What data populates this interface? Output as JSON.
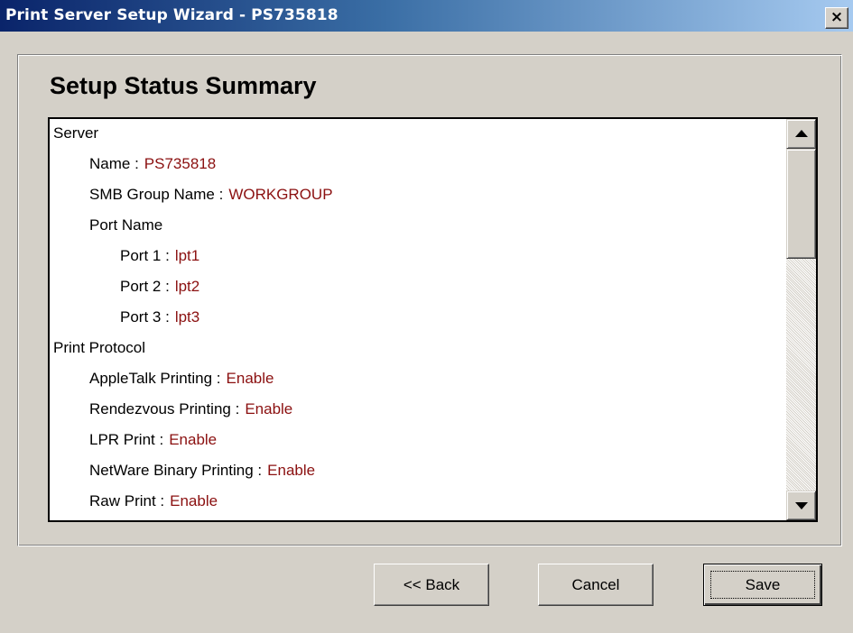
{
  "window": {
    "title": "Print Server Setup Wizard - PS735818",
    "close_glyph": "×"
  },
  "heading": "Setup Status Summary",
  "summary": {
    "rows": [
      {
        "label": "Server",
        "value": ""
      },
      {
        "label": "Name :",
        "value": "PS735818"
      },
      {
        "label": "SMB Group Name :",
        "value": "WORKGROUP"
      },
      {
        "label": "Port Name",
        "value": ""
      },
      {
        "label": "Port 1 :",
        "value": "lpt1"
      },
      {
        "label": "Port 2 :",
        "value": "lpt2"
      },
      {
        "label": "Port 3 :",
        "value": "lpt3"
      },
      {
        "label": "Print Protocol",
        "value": ""
      },
      {
        "label": "AppleTalk Printing :",
        "value": "Enable"
      },
      {
        "label": "Rendezvous Printing :",
        "value": "Enable"
      },
      {
        "label": "LPR Print :",
        "value": "Enable"
      },
      {
        "label": "NetWare Binary Printing :",
        "value": "Enable"
      },
      {
        "label": "Raw Print :",
        "value": "Enable"
      }
    ]
  },
  "buttons": {
    "back": "<< Back",
    "cancel": "Cancel",
    "save": "Save"
  },
  "icons": {
    "close": "close-icon",
    "scroll_up": "arrow-up-icon",
    "scroll_down": "arrow-down-icon"
  },
  "colors": {
    "title_bar_start": "#0a246a",
    "value_text": "#8b1010",
    "dialog_face": "#d4d0c8"
  }
}
